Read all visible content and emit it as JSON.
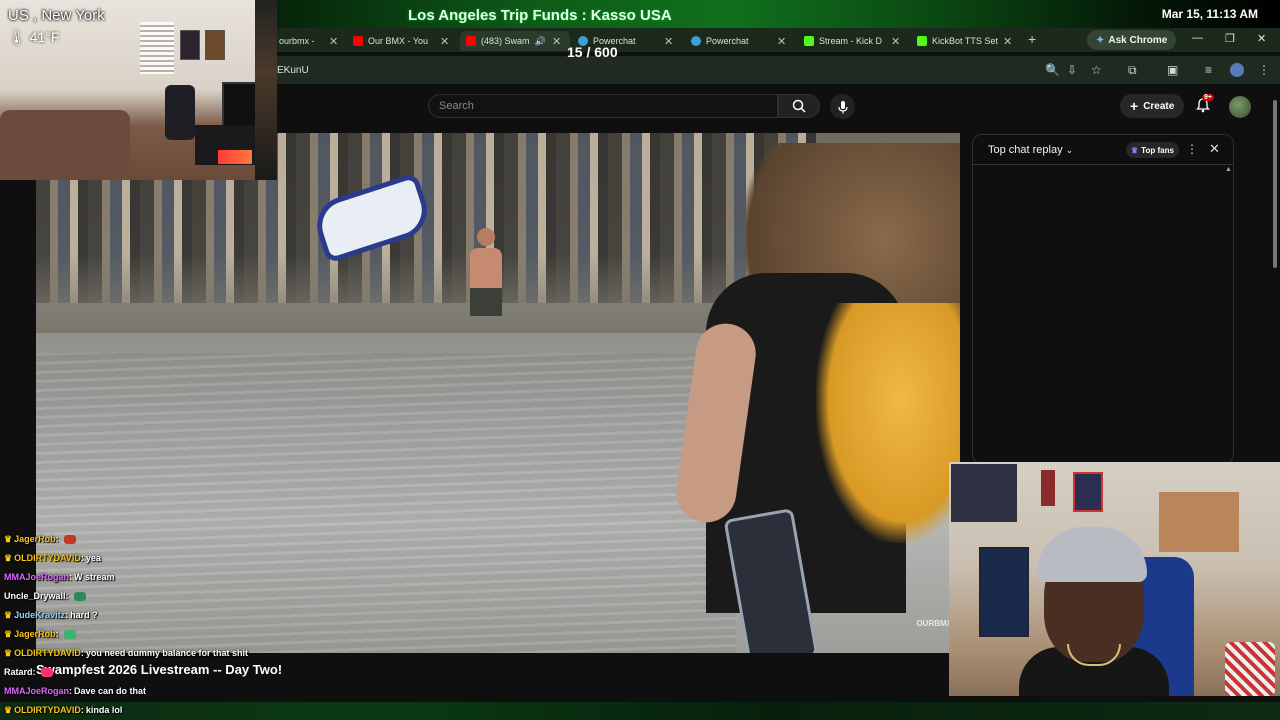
{
  "goal": {
    "title": "Los Angeles Trip Funds : Kasso USA",
    "count": "15 / 600"
  },
  "clock": "Mar 15, 11:13 AM",
  "weather": {
    "location": "US , New York",
    "temperature": "41°F"
  },
  "tabs": [
    {
      "label": "ourbmx -",
      "color": "#1f1f1f"
    },
    {
      "label": "Our BMX - You",
      "color": "#ff0000"
    },
    {
      "label": "(483) Swam",
      "color": "#ff0000"
    },
    {
      "label": "Powerchat",
      "color": "#3aa0d8"
    },
    {
      "label": "Powerchat",
      "color": "#3aa0d8"
    },
    {
      "label": "Stream - Kick D",
      "color": "#53fc18"
    },
    {
      "label": "KickBot TTS Set",
      "color": "#53fc18"
    }
  ],
  "ask_chrome": "Ask Chrome",
  "url": "EKunU",
  "youtube": {
    "search_placeholder": "Search",
    "create_label": "Create",
    "notif_badge": "9+"
  },
  "video": {
    "title": "Swampfest 2026 Livestream -- Day Two!",
    "watermark": "OURBMX"
  },
  "live_chat": {
    "mode": "Top chat replay",
    "top_fans": "Top fans"
  },
  "stream_chat": [
    {
      "user": "JagerRob",
      "text": "",
      "user_color": "#f5c518",
      "crown": true,
      "emote": "#c0392b"
    },
    {
      "user": "OLDIRTYDAVID",
      "text": "yea",
      "user_color": "#f5c518",
      "crown": true,
      "emote": ""
    },
    {
      "user": "MMAJoeRogan",
      "text": "W stream",
      "user_color": "#e066ff",
      "crown": false,
      "emote": ""
    },
    {
      "user": "Uncle_Drywall",
      "text": "",
      "user_color": "#ffffff",
      "crown": false,
      "emote": "#2e8b57"
    },
    {
      "user": "JudeKravitz",
      "text": "hard ?",
      "user_color": "#8fd4ff",
      "crown": true,
      "emote": ""
    },
    {
      "user": "JagerRob",
      "text": "",
      "user_color": "#f5c518",
      "crown": true,
      "emote": "#3cb371"
    },
    {
      "user": "OLDIRTYDAVID",
      "text": "you need dummy balance for that shit",
      "user_color": "#f5c518",
      "crown": true,
      "emote": ""
    },
    {
      "user": "Ratard",
      "text": "",
      "user_color": "#ffffff",
      "crown": false,
      "emote": "#ff3366"
    },
    {
      "user": "MMAJoeRogan",
      "text": "Dave can do that",
      "user_color": "#e066ff",
      "crown": false,
      "emote": ""
    },
    {
      "user": "OLDIRTYDAVID",
      "text": "kinda lol",
      "user_color": "#f5c518",
      "crown": true,
      "emote": ""
    }
  ]
}
